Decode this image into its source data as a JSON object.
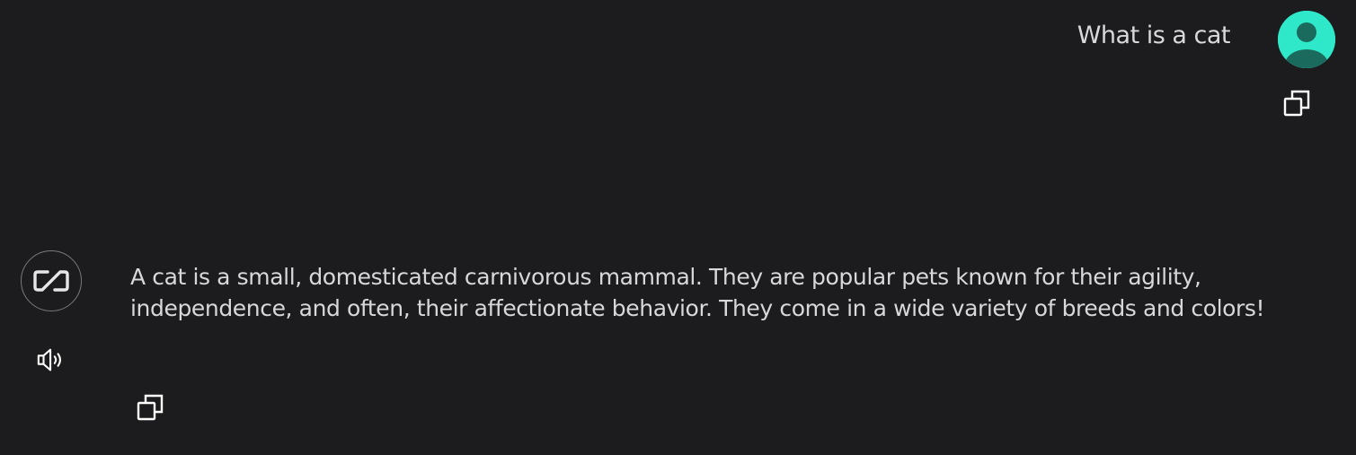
{
  "user_message": {
    "text": "What is a cat",
    "avatar_icon": "user-avatar-icon",
    "avatar_color": "#2ee8c9",
    "copy_icon": "copy-icon"
  },
  "assistant_message": {
    "text": "A cat is a small, domesticated carnivorous mammal. They are popular pets known for their agility, independence, and often, their affectionate behavior. They come in a wide variety of breeds and colors!",
    "avatar_icon": "assistant-logo-icon",
    "speaker_icon": "speaker-icon",
    "copy_icon": "copy-icon"
  },
  "colors": {
    "background": "#1c1c1e",
    "text": "#d8d8da",
    "icon": "#ffffff"
  }
}
